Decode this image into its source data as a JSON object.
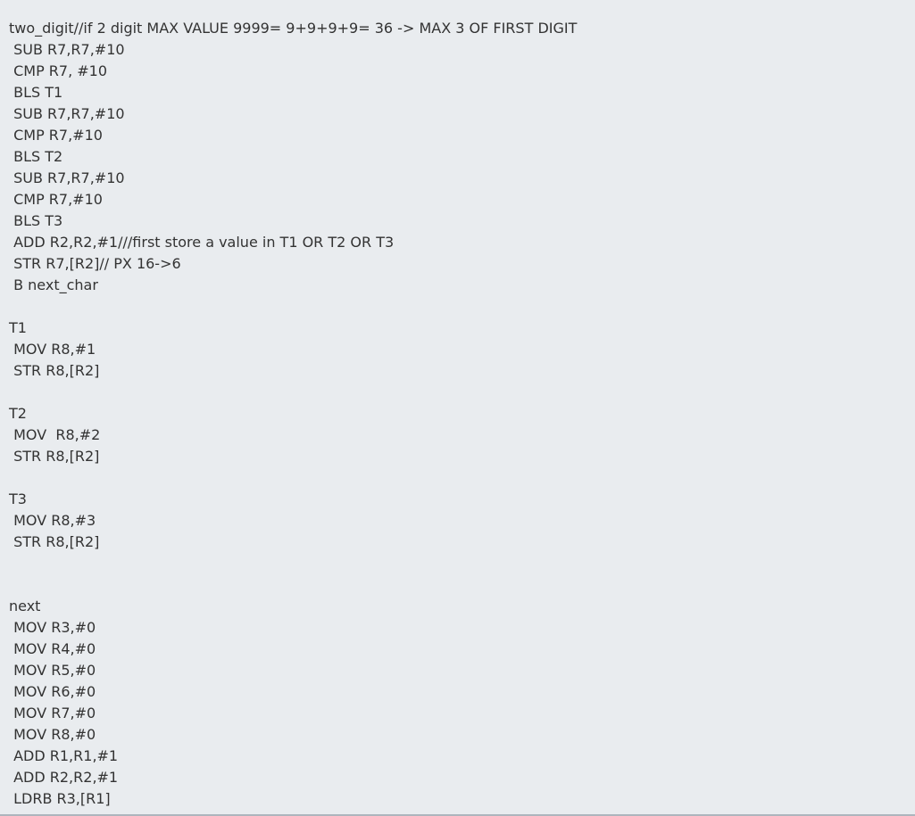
{
  "code": {
    "lines": [
      "two_digit//if 2 digit MAX VALUE 9999= 9+9+9+9= 36 -> MAX 3 OF FIRST DIGIT",
      " SUB R7,R7,#10",
      " CMP R7, #10",
      " BLS T1",
      " SUB R7,R7,#10",
      " CMP R7,#10",
      " BLS T2",
      " SUB R7,R7,#10",
      " CMP R7,#10",
      " BLS T3",
      " ADD R2,R2,#1///first store a value in T1 OR T2 OR T3",
      " STR R7,[R2]// PX 16->6",
      " B next_char",
      "",
      "T1",
      " MOV R8,#1",
      " STR R8,[R2]",
      "",
      "T2",
      " MOV  R8,#2",
      " STR R8,[R2]",
      "",
      "T3",
      " MOV R8,#3",
      " STR R8,[R2]",
      "",
      "",
      "next",
      " MOV R3,#0",
      " MOV R4,#0",
      " MOV R5,#0",
      " MOV R6,#0",
      " MOV R7,#0",
      " MOV R8,#0",
      " ADD R1,R1,#1",
      " ADD R2,R2,#1",
      " LDRB R3,[R1]"
    ]
  }
}
